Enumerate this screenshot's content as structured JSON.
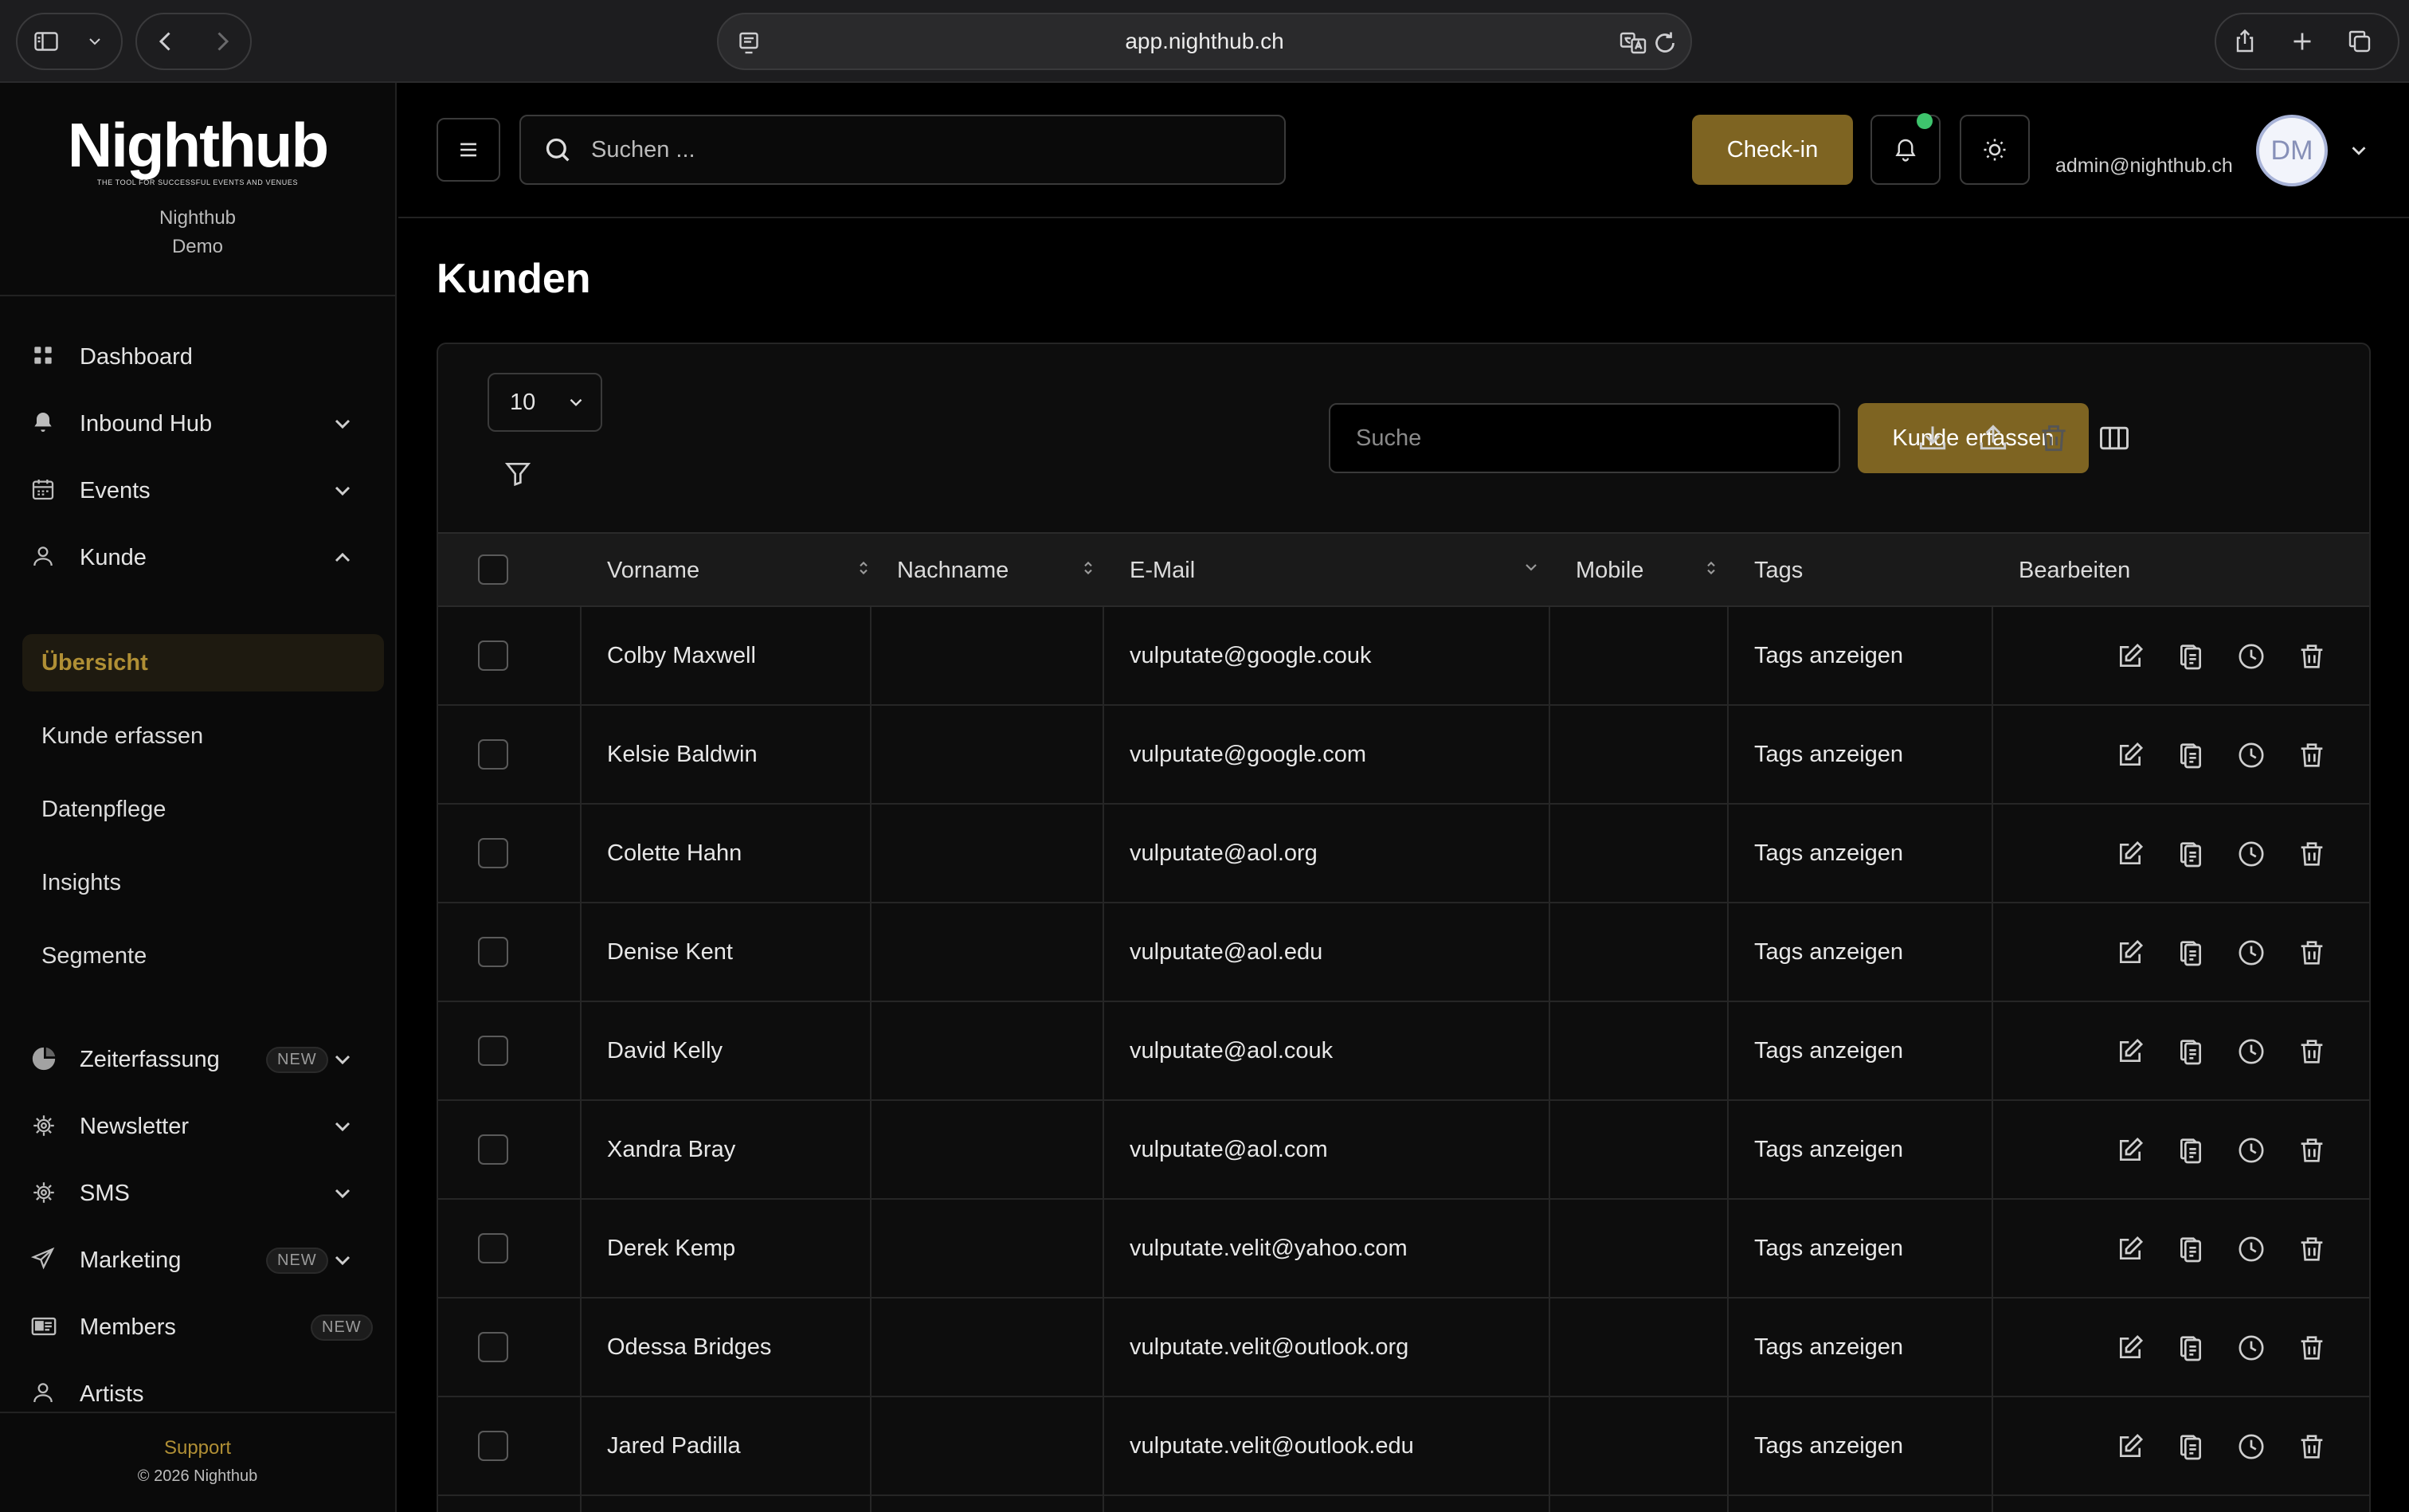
{
  "browser": {
    "url": "app.nighthub.ch"
  },
  "sidebar": {
    "logo": "Nighthub",
    "tagline": "THE TOOL FOR SUCCESSFUL EVENTS AND VENUES",
    "org_line1": "Nighthub",
    "org_line2": "Demo",
    "nav": [
      {
        "label": "Dashboard",
        "icon": "grid-icon"
      },
      {
        "label": "Inbound Hub",
        "icon": "bell-icon"
      },
      {
        "label": "Events",
        "icon": "calendar-icon"
      },
      {
        "label": "Kunde",
        "icon": "user-icon"
      }
    ],
    "sub": [
      {
        "label": "Übersicht"
      },
      {
        "label": "Kunde erfassen"
      },
      {
        "label": "Datenpflege"
      },
      {
        "label": "Insights"
      },
      {
        "label": "Segmente"
      }
    ],
    "nav2": [
      {
        "label": "Zeiterfassung",
        "icon": "clock-pie-icon",
        "badge": "NEW"
      },
      {
        "label": "Newsletter",
        "icon": "newsletter-icon"
      },
      {
        "label": "SMS",
        "icon": "sms-icon"
      },
      {
        "label": "Marketing",
        "icon": "send-icon",
        "badge": "NEW"
      },
      {
        "label": "Members",
        "icon": "member-card-icon",
        "badge": "NEW"
      },
      {
        "label": "Artists",
        "icon": "user-icon"
      }
    ],
    "support": "Support",
    "copyright": "© 2026 Nighthub"
  },
  "topbar": {
    "search_placeholder": "Suchen ...",
    "checkin": "Check-in",
    "user_email": "admin@nighthub.ch",
    "avatar_initials": "DM"
  },
  "page": {
    "title": "Kunden"
  },
  "toolbar": {
    "page_size": "10",
    "search_placeholder": "Suche",
    "add_button": "Kunde erfassen"
  },
  "table": {
    "columns": [
      "Vorname",
      "Nachname",
      "E-Mail",
      "Mobile",
      "Tags",
      "Bearbeiten"
    ],
    "rows": [
      {
        "vorname": "Colby Maxwell",
        "nachname": "",
        "email": "vulputate@google.couk",
        "mobile": "",
        "tags": "Tags anzeigen"
      },
      {
        "vorname": "Kelsie Baldwin",
        "nachname": "",
        "email": "vulputate@google.com",
        "mobile": "",
        "tags": "Tags anzeigen"
      },
      {
        "vorname": "Colette Hahn",
        "nachname": "",
        "email": "vulputate@aol.org",
        "mobile": "",
        "tags": "Tags anzeigen"
      },
      {
        "vorname": "Denise Kent",
        "nachname": "",
        "email": "vulputate@aol.edu",
        "mobile": "",
        "tags": "Tags anzeigen"
      },
      {
        "vorname": "David Kelly",
        "nachname": "",
        "email": "vulputate@aol.couk",
        "mobile": "",
        "tags": "Tags anzeigen"
      },
      {
        "vorname": "Xandra Bray",
        "nachname": "",
        "email": "vulputate@aol.com",
        "mobile": "",
        "tags": "Tags anzeigen"
      },
      {
        "vorname": "Derek Kemp",
        "nachname": "",
        "email": "vulputate.velit@yahoo.com",
        "mobile": "",
        "tags": "Tags anzeigen"
      },
      {
        "vorname": "Odessa Bridges",
        "nachname": "",
        "email": "vulputate.velit@outlook.org",
        "mobile": "",
        "tags": "Tags anzeigen"
      },
      {
        "vorname": "Jared Padilla",
        "nachname": "",
        "email": "vulputate.velit@outlook.edu",
        "mobile": "",
        "tags": "Tags anzeigen"
      }
    ]
  },
  "colors": {
    "accent": "#7e6422",
    "accent_text": "#b08f35",
    "background": "#000000",
    "notification_dot": "#3ec46d"
  }
}
